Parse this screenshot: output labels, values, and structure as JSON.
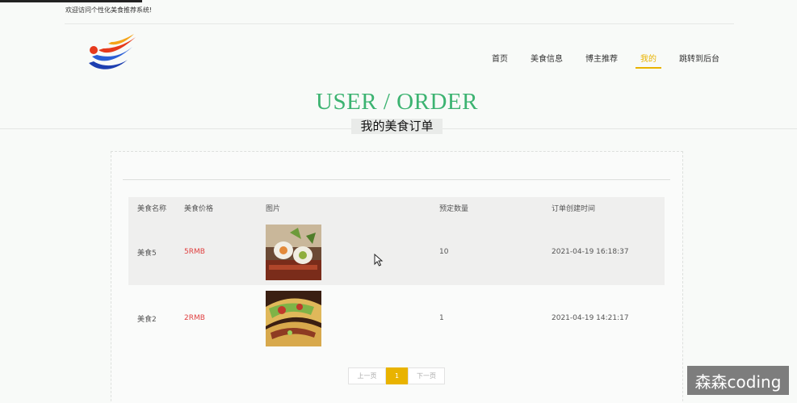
{
  "header": {
    "welcome_text": "欢迎访问个性化美食推荐系统!"
  },
  "nav": {
    "items": [
      {
        "label": "首页",
        "active": false
      },
      {
        "label": "美食信息",
        "active": false
      },
      {
        "label": "博主推荐",
        "active": false
      },
      {
        "label": "我的",
        "active": true
      },
      {
        "label": "跳转到后台",
        "active": false
      }
    ],
    "accent_color": "#e9b300"
  },
  "hero": {
    "title": "USER / ORDER",
    "subtitle": "我的美食订单",
    "title_color": "#3cb371"
  },
  "table": {
    "headers": [
      "美食名称",
      "美食价格",
      "图片",
      "预定数量",
      "订单创建时间"
    ],
    "rows": [
      {
        "name": "美食5",
        "price": "5RMB",
        "image": "sushi-roll-photo",
        "quantity": "10",
        "created": "2021-04-19 16:18:37"
      },
      {
        "name": "美食2",
        "price": "2RMB",
        "image": "taco-photo",
        "quantity": "1",
        "created": "2021-04-19 14:21:17"
      }
    ],
    "price_color": "#e04040"
  },
  "pagination": {
    "prev_label": "上一页",
    "current_page": "1",
    "next_label": "下一页"
  },
  "watermark": {
    "text": "森森coding"
  }
}
